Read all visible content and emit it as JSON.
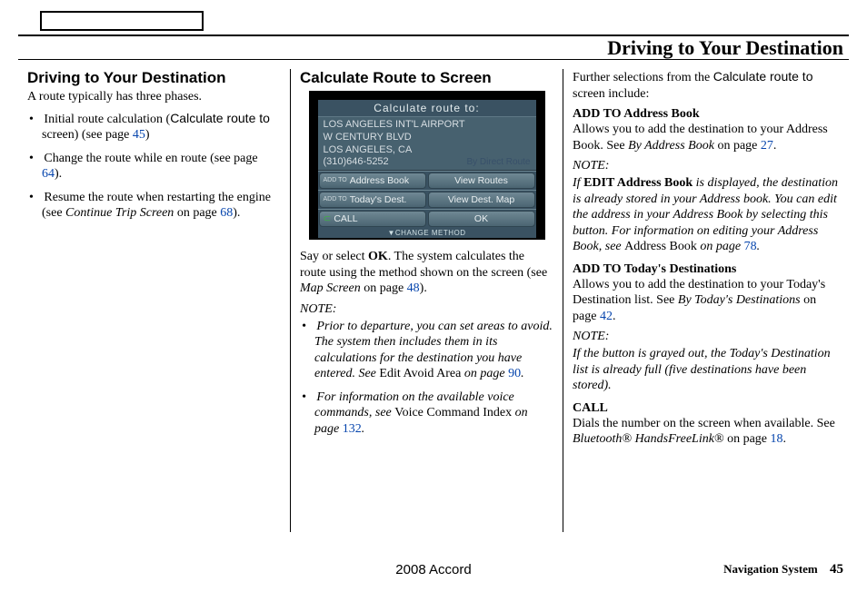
{
  "header": {
    "title": "Driving to Your Destination"
  },
  "col1": {
    "title": "Driving to Your Destination",
    "intro": "A route typically has three phases.",
    "b1_a": "Initial route calculation (",
    "b1_b": "Calculate route to",
    "b1_c": " screen) (see page ",
    "b1_page": "45",
    "b1_d": ")",
    "b2_a": "Change the route while en route (see page ",
    "b2_page": "64",
    "b2_b": ").",
    "b3_a": "Resume the route when restarting the engine (see ",
    "b3_i": "Continue Trip Screen",
    "b3_b": " on page ",
    "b3_page": "68",
    "b3_c": ")."
  },
  "col2": {
    "title": "Calculate Route to Screen",
    "screen": {
      "title": "Calculate route to:",
      "line1": "LOS ANGELES INT'L AIRPORT",
      "line2": "W CENTURY BLVD",
      "line3": "LOS ANGELES, CA",
      "phone": "(310)646-5252",
      "route_method": "By Direct Route",
      "btn_addr_small": "ADD TO",
      "btn_addr": "Address Book",
      "btn_view_routes": "View Routes",
      "btn_today_small": "ADD TO",
      "btn_today": "Today's Dest.",
      "btn_view_map": "View Dest. Map",
      "btn_call": "CALL",
      "btn_ok": "OK",
      "change": "▼CHANGE METHOD"
    },
    "p1_a": "Say or select ",
    "p1_ok": "OK",
    "p1_b": ". The system calculates the route using the method shown on the screen (see ",
    "p1_i": "Map Screen",
    "p1_c": " on page ",
    "p1_page": "48",
    "p1_d": ").",
    "note_label": "NOTE:",
    "n1_a": "Prior to departure, you can set areas to avoid. The system then includes them in its calculations for the destination you have entered. See ",
    "n1_r": "Edit Avoid Area",
    "n1_b": " on page ",
    "n1_page": "90",
    "n1_c": ".",
    "n2_a": "For information on the available voice commands, see ",
    "n2_r": "Voice Command Index",
    "n2_b": " on page ",
    "n2_page": "132",
    "n2_c": "."
  },
  "col3": {
    "intro_a": "Further selections from the ",
    "intro_b": "Calculate route to",
    "intro_c": " screen include:",
    "h1": "ADD TO Address Book",
    "p1_a": "Allows you to add the destination to your Address Book. See ",
    "p1_i": "By Address Book",
    "p1_b": " on page ",
    "p1_page": "27",
    "p1_c": ".",
    "note_label": "NOTE:",
    "note1_a": "If ",
    "note1_b": "EDIT Address Book",
    "note1_c": " is displayed, the destination is already stored in your Address book. You can edit the address in your Address Book by selecting this button. For information on editing your Address Book, see ",
    "note1_r": "Address Book",
    "note1_d": " on page ",
    "note1_page": "78",
    "note1_e": ".",
    "h2": "ADD TO Today's Destinations",
    "p2_a": "Allows you to add the destination to your Today's Destination list. See ",
    "p2_i": "By Today's Destinations",
    "p2_b": " on page ",
    "p2_page": "42",
    "p2_c": ".",
    "note2": "If the button is grayed out, the Today's Destination list is already full (five destinations have been stored).",
    "h3": "CALL",
    "p3_a": "Dials the number on the screen when available. See ",
    "p3_i": "Bluetooth® HandsFreeLink®",
    "p3_b": " on page ",
    "p3_page": "18",
    "p3_c": "."
  },
  "footer": {
    "model": "2008  Accord",
    "label": "Navigation System",
    "page": "45"
  }
}
